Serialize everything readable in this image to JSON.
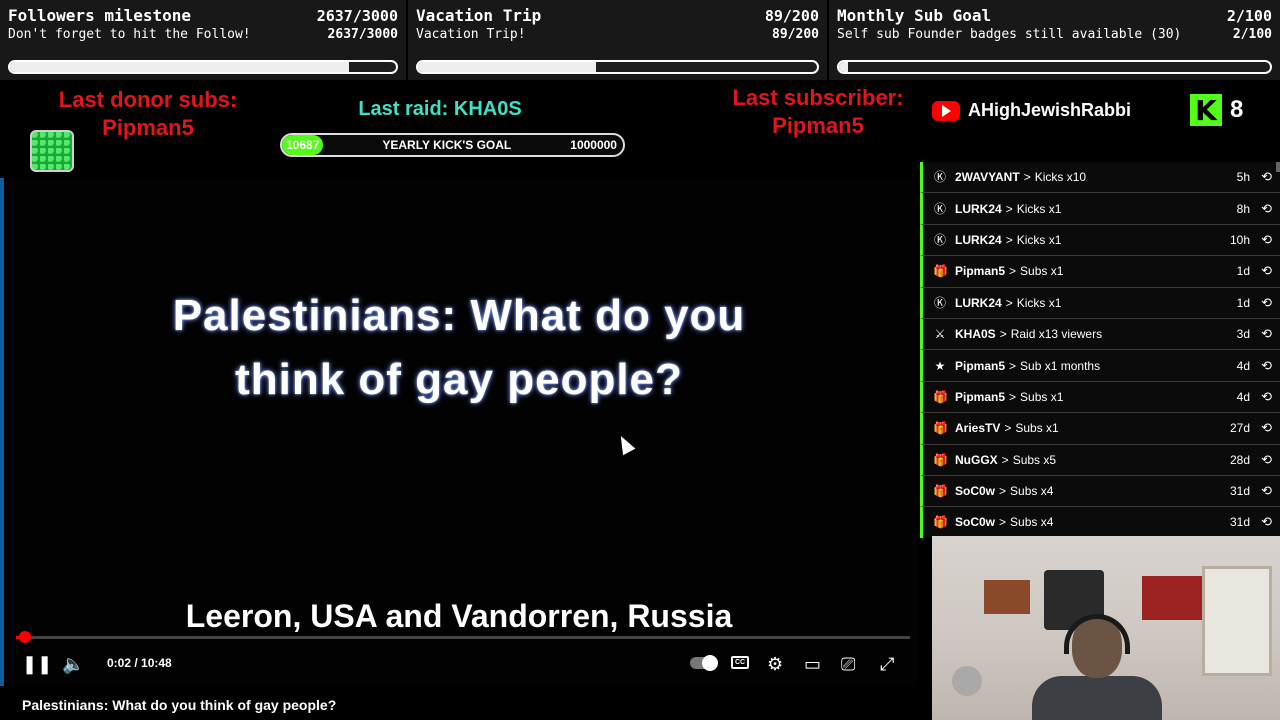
{
  "goals": [
    {
      "title": "Followers milestone",
      "count": "2637/3000",
      "subtitle": "Don't forget to hit the Follow!",
      "sub_count": "2637/3000",
      "progress": 0.879
    },
    {
      "title": "Vacation Trip",
      "count": "89/200",
      "subtitle": "Vacation Trip!",
      "sub_count": "89/200",
      "progress": 0.445
    },
    {
      "title": "Monthly Sub Goal",
      "count": "2/100",
      "subtitle": "Self sub Founder badges still available (30)",
      "sub_count": "2/100",
      "progress": 0.02
    }
  ],
  "info": {
    "donor_label": "Last donor subs:",
    "donor_name": "Pipman5",
    "raid": "Last raid: KHA0S",
    "kick_goal_current": "10687",
    "kick_goal_label": "YEARLY KICK'S GOAL",
    "kick_goal_target": "1000000",
    "kick_goal_progress": 0.0107,
    "subscriber_label": "Last subscriber:",
    "subscriber_name": "Pipman5",
    "youtube_name": "AHighJewishRabbi",
    "kick_viewers": "8"
  },
  "video": {
    "title_line1": "Palestinians: What do you",
    "title_line2": "think of gay people?",
    "names": "Leeron, USA and Vandorren, Russia",
    "time": "0:02 / 10:48",
    "progress": 0.003,
    "page_title": "Palestinians: What do you think of gay people?"
  },
  "feed": [
    {
      "icon": "kick-icon",
      "glyph": "Ⓚ",
      "name": "2WAVYANT",
      "action": "Kicks x10",
      "time": "5h"
    },
    {
      "icon": "kick-icon",
      "glyph": "Ⓚ",
      "name": "LURK24",
      "action": "Kicks x1",
      "time": "8h"
    },
    {
      "icon": "kick-icon",
      "glyph": "Ⓚ",
      "name": "LURK24",
      "action": "Kicks x1",
      "time": "10h"
    },
    {
      "icon": "gift-icon",
      "glyph": "🎁",
      "name": "Pipman5",
      "action": "Subs x1",
      "time": "1d"
    },
    {
      "icon": "kick-icon",
      "glyph": "Ⓚ",
      "name": "LURK24",
      "action": "Kicks x1",
      "time": "1d"
    },
    {
      "icon": "raid-icon",
      "glyph": "⚔",
      "name": "KHA0S",
      "action": "Raid x13 viewers",
      "time": "3d"
    },
    {
      "icon": "star-icon",
      "glyph": "★",
      "name": "Pipman5",
      "action": "Sub x1 months",
      "time": "4d"
    },
    {
      "icon": "gift-icon",
      "glyph": "🎁",
      "name": "Pipman5",
      "action": "Subs x1",
      "time": "4d"
    },
    {
      "icon": "gift-icon",
      "glyph": "🎁",
      "name": "AriesTV",
      "action": "Subs x1",
      "time": "27d"
    },
    {
      "icon": "gift-icon",
      "glyph": "🎁",
      "name": "NuGGX",
      "action": "Subs x5",
      "time": "28d"
    },
    {
      "icon": "gift-icon",
      "glyph": "🎁",
      "name": "SoC0w",
      "action": "Subs x4",
      "time": "31d"
    },
    {
      "icon": "gift-icon",
      "glyph": "🎁",
      "name": "SoC0w",
      "action": "Subs x4",
      "time": "31d"
    }
  ],
  "colors": {
    "accent_green": "#53fc18",
    "alert_red": "#e0161b",
    "raid_teal": "#3fe0c3",
    "youtube_red": "#ff0000"
  }
}
